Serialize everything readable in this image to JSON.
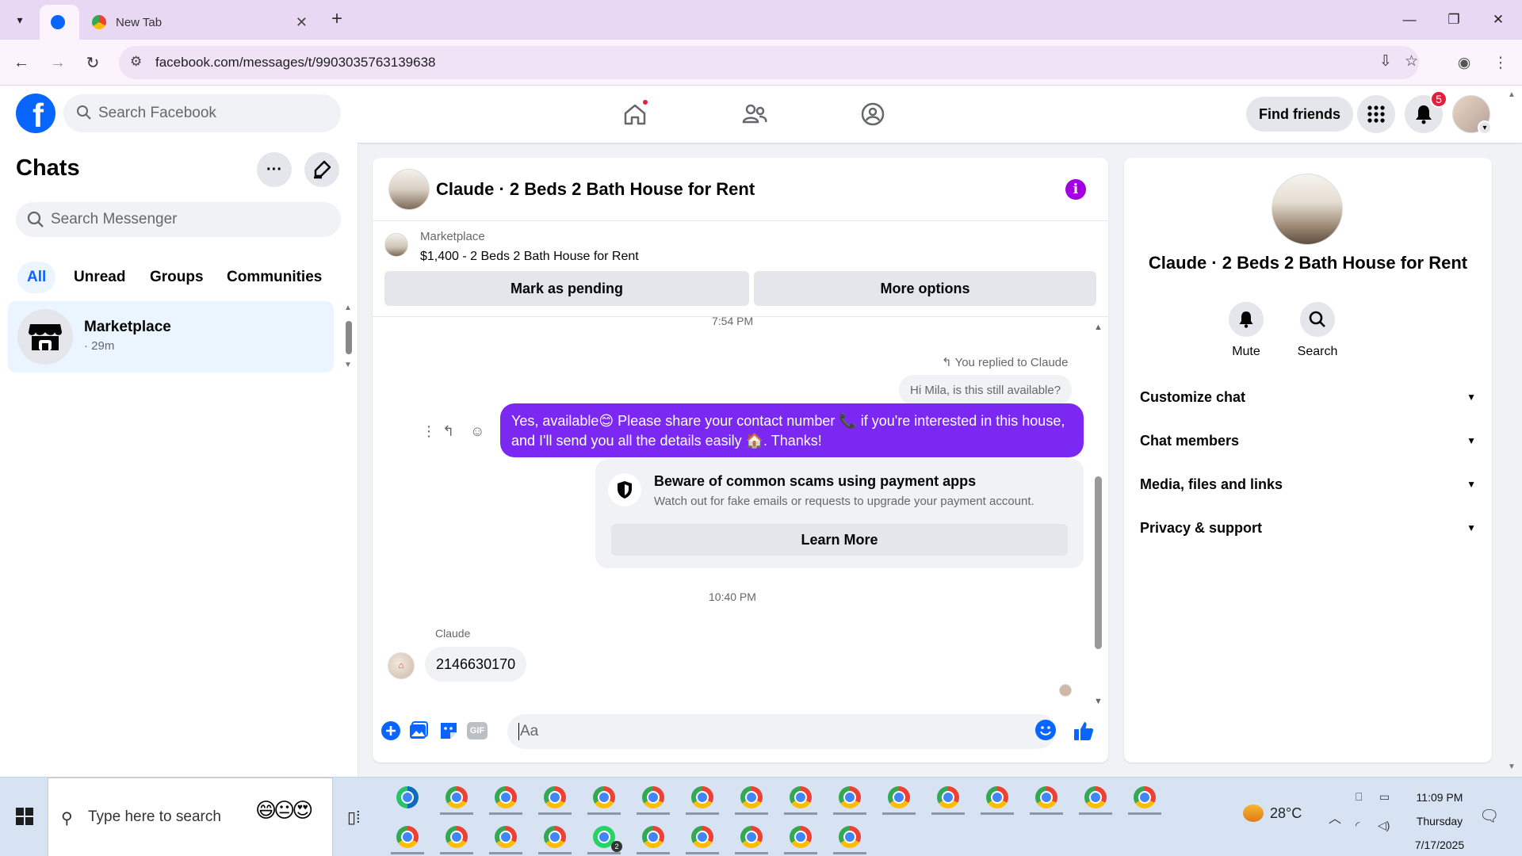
{
  "browser": {
    "tabs": [
      {
        "title": "",
        "favicon": "facebook-icon",
        "active": true
      },
      {
        "title": "New Tab",
        "favicon": "chrome-icon",
        "active": false
      }
    ],
    "url": "facebook.com/messages/t/9903035763139638"
  },
  "fb_header": {
    "search_placeholder": "Search Facebook",
    "find_friends": "Find friends",
    "notification_count": "5",
    "brand_color": "#0866ff"
  },
  "chats": {
    "title": "Chats",
    "search_placeholder": "Search Messenger",
    "filters": [
      "All",
      "Unread",
      "Groups",
      "Communities"
    ],
    "active_filter": "All",
    "items": [
      {
        "name": "Marketplace",
        "time": "· 29m"
      }
    ]
  },
  "conversation": {
    "title": "Claude · 2 Beds 2 Bath House for Rent",
    "marketplace_label": "Marketplace",
    "listing": "$1,400 - 2 Beds 2 Bath House for Rent",
    "mark_pending": "Mark as pending",
    "more_options": "More options",
    "time_1": "7:54 PM",
    "replied_label": "You replied to Claude",
    "quoted_text": "Hi Mila, is this still available?",
    "my_message": "Yes, available😊 Please share your contact number 📞 if you're interested in this house, and I'll send you all the details easily 🏠. Thanks!",
    "scam_title": "Beware of common scams using payment apps",
    "scam_desc": "Watch out for fake emails or requests to upgrade your payment account.",
    "learn_more": "Learn More",
    "time_2": "10:40 PM",
    "sender": "Claude",
    "their_message": "2146630170",
    "composer_placeholder": "Aa",
    "my_bubble_color": "#7b29f2"
  },
  "info_panel": {
    "name": "Claude · 2 Beds 2 Bath House for Rent",
    "mute": "Mute",
    "search": "Search",
    "sections": [
      "Customize chat",
      "Chat members",
      "Media, files and links",
      "Privacy & support"
    ]
  },
  "taskbar": {
    "search_placeholder": "Type here to search",
    "emojis": "😄😐😍",
    "weather": "28°C",
    "time": "11:09 PM",
    "day": "Thursday",
    "date": "7/17/2025",
    "whatsapp_badge": "2"
  }
}
